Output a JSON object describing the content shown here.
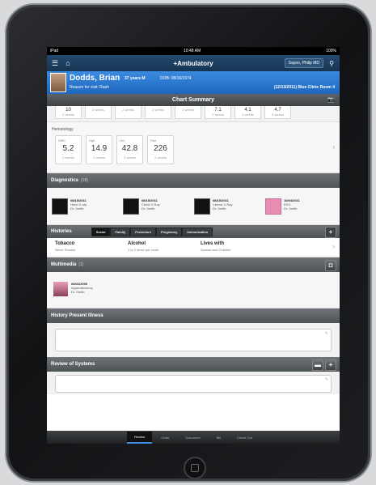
{
  "status": {
    "carrier": "iPad",
    "time": "10:48 AM",
    "battery": "100%"
  },
  "nav": {
    "title": "+Ambulatory",
    "user": "Sayeo, Philip MD",
    "menu_icon": "menu-icon",
    "home_icon": "home-icon",
    "search_icon": "search-icon"
  },
  "patient": {
    "name": "Dodds, Brian",
    "meta": "37 years M",
    "dob": "DOB: 08/16/1974",
    "reason": "Reason for visit: Rash",
    "visit": "(12/13/2011) Blue Clinic Room 4"
  },
  "summary": {
    "title": "Chart Summary"
  },
  "top_tiles": [
    {
      "value": "10",
      "sub": "2 weeks"
    },
    {
      "value": "",
      "sub": "2 weeks"
    },
    {
      "value": "",
      "sub": "2 weeks"
    },
    {
      "value": "",
      "sub": "2 weeks"
    },
    {
      "value": "",
      "sub": "2 weeks"
    },
    {
      "value": "7.1",
      "sub": "2 weeks"
    },
    {
      "value": "4.1",
      "sub": "2 weeks"
    },
    {
      "value": "4.7",
      "sub": "2 weeks"
    }
  ],
  "hematology": {
    "label": "Hematology",
    "cards": [
      {
        "key": "WBC",
        "value": "5.2",
        "sub": "2 weeks"
      },
      {
        "key": "Hgb",
        "value": "14.9",
        "sub": "2 weeks"
      },
      {
        "key": "Hct",
        "value": "42.8",
        "sub": "2 weeks"
      },
      {
        "key": "Plat",
        "value": "226",
        "sub": "2 weeks"
      }
    ]
  },
  "diagnostics": {
    "label": "Diagnostics",
    "count": "(18)",
    "items": [
      {
        "date": "08/15/2011",
        "name": "Hand X-ray",
        "doc": "Dr. Smith",
        "thumb": "dark"
      },
      {
        "date": "08/15/2011",
        "name": "Chest X-Ray",
        "doc": "Dr. Smith",
        "thumb": "dark"
      },
      {
        "date": "08/15/2011",
        "name": "Lateral X-Ray",
        "doc": "Dr. Smith",
        "thumb": "dark"
      },
      {
        "date": "10/04/2011",
        "name": "EKG",
        "doc": "Dr. Smith",
        "thumb": "pink"
      }
    ]
  },
  "histories": {
    "label": "Histories",
    "tabs": [
      "Social",
      "Family",
      "Procedure",
      "Pregnancy",
      "Immunization"
    ],
    "active_tab": "Social",
    "cols": [
      {
        "head": "Tobacco",
        "detail": "Never Smoker"
      },
      {
        "head": "Alcohol",
        "detail": "1 to 2 times per week"
      },
      {
        "head": "Lives with",
        "detail": "Spouse and Children"
      }
    ]
  },
  "multimedia": {
    "label": "Multimedia",
    "count": "(1)",
    "date": "08/02/2009",
    "name": "Appendectomy",
    "doc": "Dr. Smith"
  },
  "hpi": {
    "label": "History Present Illness"
  },
  "ros": {
    "label": "Review of Systems"
  },
  "tabbar": {
    "tabs": [
      "Review",
      "Order",
      "Document",
      "Bill",
      "Check Out"
    ],
    "active": "Review"
  }
}
